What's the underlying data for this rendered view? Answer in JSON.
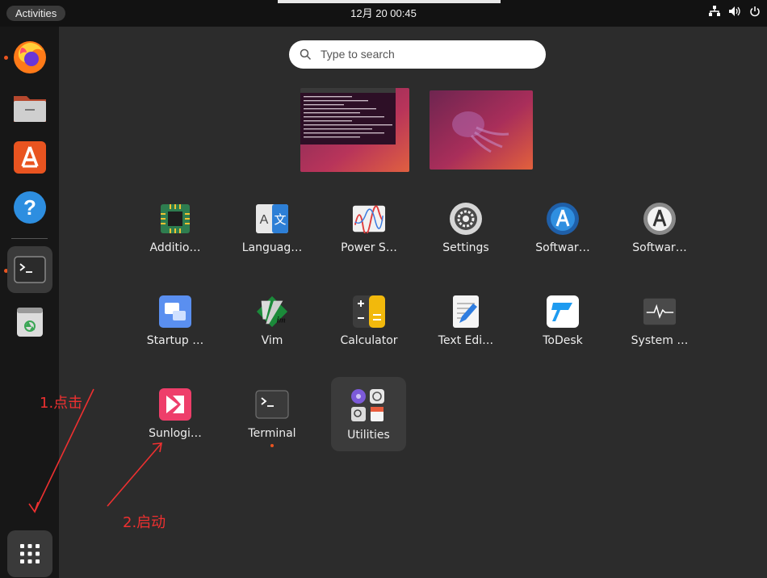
{
  "topbar": {
    "activities": "Activities",
    "clock": "12月 20  00:45",
    "tray_icons": [
      "network-icon",
      "volume-icon",
      "power-icon"
    ]
  },
  "dock": {
    "items": [
      {
        "name": "firefox",
        "running": true
      },
      {
        "name": "files",
        "running": false
      },
      {
        "name": "app-center",
        "running": false
      },
      {
        "name": "help",
        "running": false
      },
      {
        "name": "terminal",
        "running": true,
        "active": true
      },
      {
        "name": "trash",
        "running": false
      }
    ],
    "show_apps": "show-applications"
  },
  "search": {
    "placeholder": "Type to search"
  },
  "apps": [
    {
      "label": "Additio…",
      "icon": "additional-drivers-icon"
    },
    {
      "label": "Languag…",
      "icon": "language-support-icon"
    },
    {
      "label": "Power S…",
      "icon": "power-statistics-icon"
    },
    {
      "label": "Settings",
      "icon": "settings-icon"
    },
    {
      "label": "Softwar…",
      "icon": "software-updater-icon"
    },
    {
      "label": "Softwar…",
      "icon": "software-properties-icon"
    },
    {
      "label": "Startup …",
      "icon": "startup-applications-icon"
    },
    {
      "label": "Vim",
      "icon": "vim-icon"
    },
    {
      "label": "Calculator",
      "icon": "calculator-icon"
    },
    {
      "label": "Text Edi…",
      "icon": "text-editor-icon"
    },
    {
      "label": "ToDesk",
      "icon": "todesk-icon"
    },
    {
      "label": "System …",
      "icon": "system-monitor-icon"
    },
    {
      "label": "Sunlogi…",
      "icon": "sunlogin-icon"
    },
    {
      "label": "Terminal",
      "icon": "terminal-icon",
      "running": true
    },
    {
      "label": "Utilities",
      "icon": "utilities-folder-icon"
    }
  ],
  "annotations": {
    "step1": "1.点击",
    "step2": "2.启动",
    "color": "#ee3030"
  },
  "colors": {
    "accent": "#e95420",
    "panel": "#121212",
    "dock": "#171717",
    "overview": "#2c2c2c"
  }
}
